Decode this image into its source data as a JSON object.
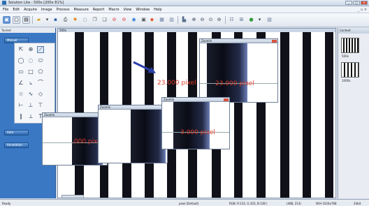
{
  "window": {
    "title": "Solution Lite - 500x [200x 81%]"
  },
  "menu": [
    "File",
    "Edit",
    "Acquire",
    "Image",
    "Process",
    "Measure",
    "Report",
    "Macro",
    "View",
    "Window",
    "Help"
  ],
  "toolset": {
    "header": "Toolset",
    "section_manual": "Manual",
    "section_auto": "Auto",
    "section_annotation": "Annotation"
  },
  "image_window": {
    "title": "500x"
  },
  "annotation": {
    "main_measure": "23.000 pixel"
  },
  "zoom_windows": [
    {
      "title": "ZoomIn",
      "measure": "23.000 pixel"
    },
    {
      "title": "ZoomIn",
      "measure": ".000 pixel"
    },
    {
      "title": "ZoomIn",
      "measure": "3.000 pixel"
    }
  ],
  "context": {
    "title": "Context",
    "thumbs": [
      "500x",
      "1000x"
    ]
  },
  "status": {
    "ready": "Ready",
    "unit": "pixel (Default)",
    "rgb": "RGB: R:132, G:103, B:138 )",
    "xy": "(488, 214)",
    "size": "W:H 1024x768",
    "bits": "24bit"
  },
  "colors": {
    "accent": "#3a78c4",
    "measure": "#e03b2a",
    "arrow": "#2b3fa8"
  }
}
